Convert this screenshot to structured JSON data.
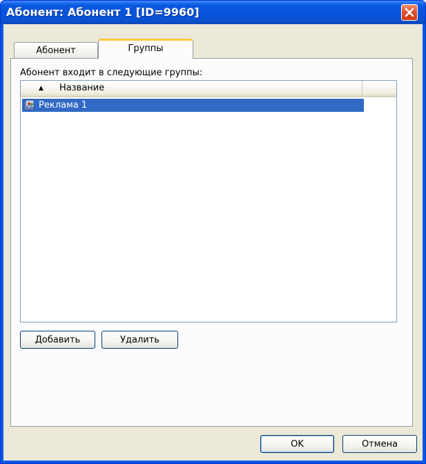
{
  "window": {
    "title": "Абонент: Абонент 1 [ID=9960]",
    "close_icon": "close-x-icon"
  },
  "tabs": [
    {
      "label": "Абонент",
      "active": false
    },
    {
      "label": "Группы",
      "active": true
    }
  ],
  "groups_panel": {
    "caption": "Абонент входит в следующие группы:",
    "column_header": "Название",
    "sort_indicator": "▲",
    "rows": [
      {
        "label": "Реклама 1",
        "selected": true,
        "icon": "group-icon"
      }
    ],
    "add_button": "Добавить",
    "remove_button": "Удалить"
  },
  "footer": {
    "ok_button": "OK",
    "cancel_button": "Отмена"
  },
  "colors": {
    "titlebar": "#0a5ae0",
    "selection": "#316ac5",
    "active_tab_accent": "#ffc83c",
    "close_button": "#e4512b",
    "dialog_face": "#ece9d8"
  }
}
